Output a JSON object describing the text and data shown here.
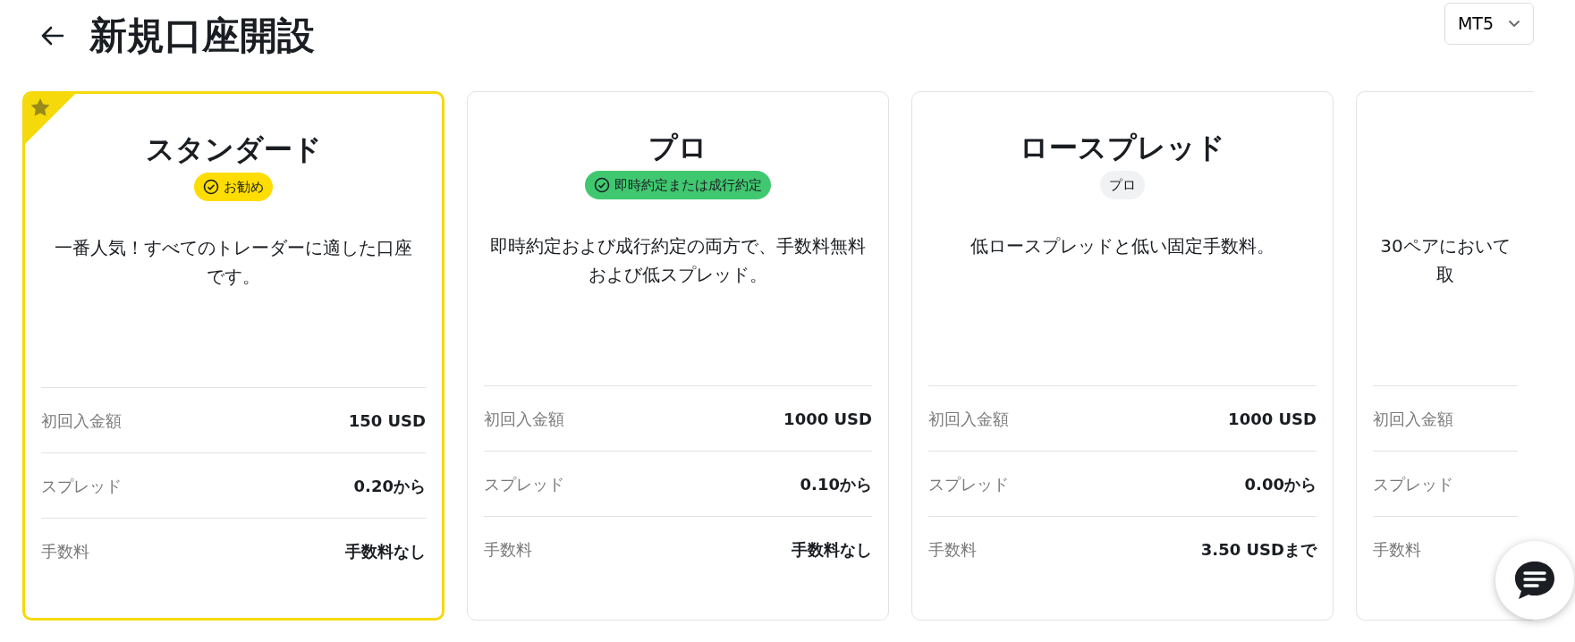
{
  "header": {
    "title": "新規口座開設",
    "platform": "MT5"
  },
  "cards": [
    {
      "featured": true,
      "title": "スタンダード",
      "badge": {
        "kind": "check",
        "color": "#ffdd00",
        "label": "お勧め"
      },
      "description": "一番人気！すべてのトレーダーに適した口座です。",
      "rows": [
        {
          "label": "初回入金額",
          "value": "150 USD"
        },
        {
          "label": "スプレッド",
          "value": "0.20から"
        },
        {
          "label": "手数料",
          "value": "手数料なし"
        }
      ]
    },
    {
      "featured": false,
      "title": "プロ",
      "badge": {
        "kind": "check",
        "color": "#40c870",
        "label": "即時約定または成行約定"
      },
      "description": "即時約定および成行約定の両方で、手数料無料および低スプレッド。",
      "rows": [
        {
          "label": "初回入金額",
          "value": "1000 USD"
        },
        {
          "label": "スプレッド",
          "value": "0.10から"
        },
        {
          "label": "手数料",
          "value": "手数料なし"
        }
      ]
    },
    {
      "featured": false,
      "title": "ロースプレッド",
      "badge": {
        "kind": "plain",
        "color": "#f1f2f4",
        "label": "プロ"
      },
      "description": "低ロースプレッドと低い固定手数料。",
      "rows": [
        {
          "label": "初回入金額",
          "value": "1000 USD"
        },
        {
          "label": "スプレッド",
          "value": "0.00から"
        },
        {
          "label": "手数料",
          "value": "3.50 USDまで"
        }
      ]
    },
    {
      "featured": false,
      "description": "30ペアにおいて取",
      "rows": [
        {
          "label": "初回入金額"
        },
        {
          "label": "スプレッド"
        },
        {
          "label": "手数料"
        }
      ]
    }
  ]
}
